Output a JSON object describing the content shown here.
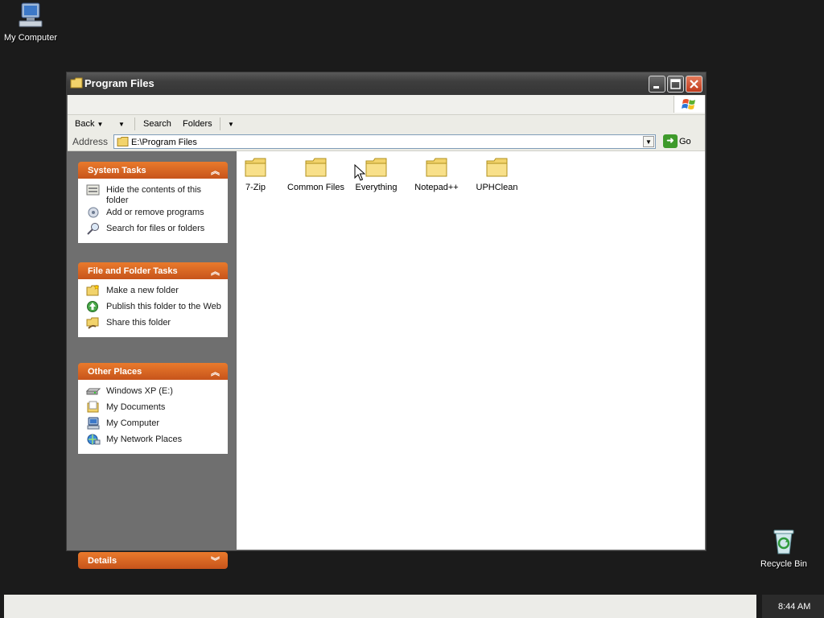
{
  "desktop": {
    "icons": [
      {
        "label": "My Computer"
      },
      {
        "label": "Recycle Bin"
      }
    ]
  },
  "window": {
    "title": "Program Files",
    "toolbar": {
      "back": "Back",
      "search": "Search",
      "folders": "Folders"
    },
    "address": {
      "label": "Address",
      "value": "E:\\Program Files",
      "go": "Go"
    },
    "tasks": {
      "system": {
        "title": "System Tasks",
        "items": [
          "Hide the contents of this folder",
          "Add or remove programs",
          "Search for files or folders"
        ]
      },
      "file_folder": {
        "title": "File and Folder Tasks",
        "items": [
          "Make a new folder",
          "Publish this folder to the Web",
          "Share this folder"
        ]
      },
      "other": {
        "title": "Other Places",
        "items": [
          "Windows XP (E:)",
          "My Documents",
          "My Computer",
          "My Network Places"
        ]
      },
      "details": {
        "title": "Details"
      }
    },
    "folders": [
      "7-Zip",
      "Common Files",
      "Everything",
      "Notepad++",
      "UPHClean"
    ]
  },
  "taskbar": {
    "clock": "8:44 AM"
  },
  "colors": {
    "panel_header": "#d9601f",
    "desktop": "#1b1b1b",
    "folder": "#f2d36b"
  }
}
